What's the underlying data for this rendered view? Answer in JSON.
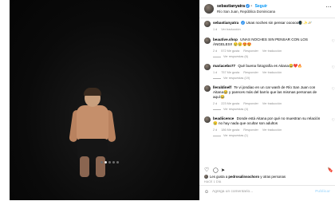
{
  "header": {
    "username": "sebastianyatra",
    "verified_mark": "✓",
    "follow_label": "Seguir",
    "location": "Río San Juan, República Dominicana",
    "more_icon": "⋯"
  },
  "caption": {
    "username": "sebastianyatra",
    "text": "Unas noches sin pensar oooooo🌒✨🪐",
    "time": "1 d",
    "translate": "Ver traducción"
  },
  "comments": [
    {
      "username": "beautive.shop",
      "text": "UNAS NOCHES SIN PENSAR CON LOS ÁNGELES!! 😢😢😍😍",
      "time": "2 d",
      "likes": "572 Me gusta",
      "reply": "Responder",
      "translate": "Ver traducción",
      "replies": "Ver respuestas (6)"
    },
    {
      "username": "mariacebo77",
      "text": "Qué buena fotografía es Aitana😂❤️🔥",
      "time": "1 d",
      "likes": "757 Me gusta",
      "reply": "Responder",
      "translate": "Ver traducción",
      "replies": "Ver respuestas (19)"
    },
    {
      "username": "lleraldinelf",
      "text": "Te vi jondiao en un car wash de Río San Juan con Aitana😂 y pareces más del barrio que las mismas personas de aquí😂",
      "time": "2 d",
      "likes": "223 Me gusta",
      "reply": "Responder",
      "translate": "Ver traducción",
      "replies": "Ver respuestas (4)"
    },
    {
      "username": "beadiicence",
      "text": "Donde está Aitana por qué no muestran su relación 😢 no hay nada que ocultar son adultos",
      "time": "2 d",
      "likes": "186 Me gusta",
      "reply": "Responder",
      "translate": "Ver traducción",
      "replies": "Ver respuestas (1)"
    }
  ],
  "actions": {
    "like_icon": "♡",
    "comment_icon": "◯",
    "share_icon": "➤",
    "save_icon": "🔖"
  },
  "likes_line": {
    "prefix": "Les gusta a",
    "user": "pedrosalinsochoro",
    "suffix": "y otras personas"
  },
  "date": "HACE 1 DÍA",
  "composer": {
    "emoji_icon": "☺",
    "placeholder": "Agrega un comentario...",
    "post_label": "Publicar"
  },
  "carousel": {
    "next_icon": "›",
    "dots": 5,
    "active_dot": 1
  },
  "colors": {
    "accent": "#0095f6",
    "verified": "#3897f0",
    "muted": "#8e8e8e"
  }
}
